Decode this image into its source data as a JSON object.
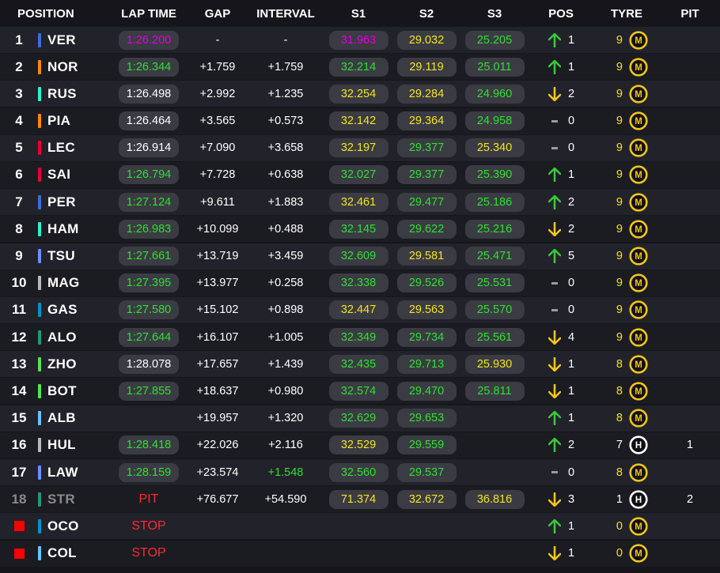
{
  "headers": {
    "position": "POSITION",
    "lap_time": "LAP TIME",
    "gap": "GAP",
    "interval": "INTERVAL",
    "s1": "S1",
    "s2": "S2",
    "s3": "S3",
    "pos": "POS",
    "tyre": "TYRE",
    "pit": "PIT"
  },
  "colors": {
    "purple": "#e100e1",
    "green": "#2ee02e",
    "yellow": "#f5e41a",
    "white": "#ffffff",
    "red_text": "#ff2a2a",
    "grey": "#8a8a8a",
    "tyre_yellow": "#f0c419",
    "tyre_white": "#ffffff",
    "arrow_up": "#37c837",
    "arrow_down": "#f5c41a"
  },
  "rows": [
    {
      "pos": "1",
      "team_color": "#3a6fd8",
      "driver": "VER",
      "lap": "1:26.200",
      "lap_color": "purple",
      "gap": "-",
      "interval": "-",
      "interval_color": "white",
      "s1": "31.963",
      "s1_color": "purple",
      "s2": "29.032",
      "s2_color": "yellow",
      "s3": "25.205",
      "s3_color": "green",
      "change": "up",
      "change_num": "1",
      "laps": "9",
      "laps_color": "yellow",
      "tyre": "M",
      "tyre_icon": "medium-tyre-icon",
      "pit": ""
    },
    {
      "pos": "2",
      "team_color": "#ff8700",
      "driver": "NOR",
      "lap": "1:26.344",
      "lap_color": "green",
      "gap": "+1.759",
      "interval": "+1.759",
      "interval_color": "white",
      "s1": "32.214",
      "s1_color": "green",
      "s2": "29.119",
      "s2_color": "yellow",
      "s3": "25.011",
      "s3_color": "green",
      "change": "up",
      "change_num": "1",
      "laps": "9",
      "laps_color": "yellow",
      "tyre": "M",
      "tyre_icon": "medium-tyre-icon",
      "pit": ""
    },
    {
      "pos": "3",
      "team_color": "#27f4d2",
      "driver": "RUS",
      "lap": "1:26.498",
      "lap_color": "white",
      "gap": "+2.992",
      "interval": "+1.235",
      "interval_color": "white",
      "s1": "32.254",
      "s1_color": "yellow",
      "s2": "29.284",
      "s2_color": "yellow",
      "s3": "24.960",
      "s3_color": "green",
      "change": "down",
      "change_num": "2",
      "laps": "9",
      "laps_color": "yellow",
      "tyre": "M",
      "tyre_icon": "medium-tyre-icon",
      "pit": ""
    },
    {
      "pos": "4",
      "team_color": "#ff8700",
      "driver": "PIA",
      "lap": "1:26.464",
      "lap_color": "white",
      "gap": "+3.565",
      "interval": "+0.573",
      "interval_color": "white",
      "s1": "32.142",
      "s1_color": "yellow",
      "s2": "29.364",
      "s2_color": "yellow",
      "s3": "24.958",
      "s3_color": "green",
      "change": "same",
      "change_num": "0",
      "laps": "9",
      "laps_color": "yellow",
      "tyre": "M",
      "tyre_icon": "medium-tyre-icon",
      "pit": ""
    },
    {
      "pos": "5",
      "team_color": "#e8002d",
      "driver": "LEC",
      "lap": "1:26.914",
      "lap_color": "white",
      "gap": "+7.090",
      "interval": "+3.658",
      "interval_color": "white",
      "s1": "32.197",
      "s1_color": "yellow",
      "s2": "29.377",
      "s2_color": "green",
      "s3": "25.340",
      "s3_color": "yellow",
      "change": "same",
      "change_num": "0",
      "laps": "9",
      "laps_color": "yellow",
      "tyre": "M",
      "tyre_icon": "medium-tyre-icon",
      "pit": ""
    },
    {
      "pos": "6",
      "team_color": "#e8002d",
      "driver": "SAI",
      "lap": "1:26.794",
      "lap_color": "green",
      "gap": "+7.728",
      "interval": "+0.638",
      "interval_color": "white",
      "s1": "32.027",
      "s1_color": "green",
      "s2": "29.377",
      "s2_color": "green",
      "s3": "25.390",
      "s3_color": "green",
      "change": "up",
      "change_num": "1",
      "laps": "9",
      "laps_color": "yellow",
      "tyre": "M",
      "tyre_icon": "medium-tyre-icon",
      "pit": ""
    },
    {
      "pos": "7",
      "team_color": "#3a6fd8",
      "driver": "PER",
      "lap": "1:27.124",
      "lap_color": "green",
      "gap": "+9.611",
      "interval": "+1.883",
      "interval_color": "white",
      "s1": "32.461",
      "s1_color": "yellow",
      "s2": "29.477",
      "s2_color": "green",
      "s3": "25.186",
      "s3_color": "green",
      "change": "up",
      "change_num": "2",
      "laps": "9",
      "laps_color": "yellow",
      "tyre": "M",
      "tyre_icon": "medium-tyre-icon",
      "pit": ""
    },
    {
      "pos": "8",
      "team_color": "#27f4d2",
      "driver": "HAM",
      "lap": "1:26.983",
      "lap_color": "green",
      "gap": "+10.099",
      "interval": "+0.488",
      "interval_color": "white",
      "s1": "32.145",
      "s1_color": "green",
      "s2": "29.622",
      "s2_color": "green",
      "s3": "25.216",
      "s3_color": "green",
      "change": "down",
      "change_num": "2",
      "laps": "9",
      "laps_color": "yellow",
      "tyre": "M",
      "tyre_icon": "medium-tyre-icon",
      "pit": ""
    },
    {
      "pos": "9",
      "team_color": "#6692ff",
      "driver": "TSU",
      "lap": "1:27.661",
      "lap_color": "green",
      "gap": "+13.719",
      "interval": "+3.459",
      "interval_color": "white",
      "s1": "32.609",
      "s1_color": "green",
      "s2": "29.581",
      "s2_color": "yellow",
      "s3": "25.471",
      "s3_color": "green",
      "change": "up",
      "change_num": "5",
      "laps": "9",
      "laps_color": "yellow",
      "tyre": "M",
      "tyre_icon": "medium-tyre-icon",
      "pit": ""
    },
    {
      "pos": "10",
      "team_color": "#b6babd",
      "driver": "MAG",
      "lap": "1:27.395",
      "lap_color": "green",
      "gap": "+13.977",
      "interval": "+0.258",
      "interval_color": "white",
      "s1": "32.338",
      "s1_color": "green",
      "s2": "29.526",
      "s2_color": "green",
      "s3": "25.531",
      "s3_color": "green",
      "change": "same",
      "change_num": "0",
      "laps": "9",
      "laps_color": "yellow",
      "tyre": "M",
      "tyre_icon": "medium-tyre-icon",
      "pit": ""
    },
    {
      "pos": "11",
      "team_color": "#0093cc",
      "driver": "GAS",
      "lap": "1:27.580",
      "lap_color": "green",
      "gap": "+15.102",
      "interval": "+0.898",
      "interval_color": "white",
      "s1": "32.447",
      "s1_color": "yellow",
      "s2": "29.563",
      "s2_color": "yellow",
      "s3": "25.570",
      "s3_color": "green",
      "change": "same",
      "change_num": "0",
      "laps": "9",
      "laps_color": "yellow",
      "tyre": "M",
      "tyre_icon": "medium-tyre-icon",
      "pit": ""
    },
    {
      "pos": "12",
      "team_color": "#229971",
      "driver": "ALO",
      "lap": "1:27.644",
      "lap_color": "green",
      "gap": "+16.107",
      "interval": "+1.005",
      "interval_color": "white",
      "s1": "32.349",
      "s1_color": "green",
      "s2": "29.734",
      "s2_color": "green",
      "s3": "25.561",
      "s3_color": "green",
      "change": "down",
      "change_num": "4",
      "laps": "9",
      "laps_color": "yellow",
      "tyre": "M",
      "tyre_icon": "medium-tyre-icon",
      "pit": ""
    },
    {
      "pos": "13",
      "team_color": "#52e252",
      "driver": "ZHO",
      "lap": "1:28.078",
      "lap_color": "white",
      "gap": "+17.657",
      "interval": "+1.439",
      "interval_color": "white",
      "s1": "32.435",
      "s1_color": "green",
      "s2": "29.713",
      "s2_color": "green",
      "s3": "25.930",
      "s3_color": "yellow",
      "change": "down",
      "change_num": "1",
      "laps": "8",
      "laps_color": "yellow",
      "tyre": "M",
      "tyre_icon": "medium-tyre-icon",
      "pit": ""
    },
    {
      "pos": "14",
      "team_color": "#52e252",
      "driver": "BOT",
      "lap": "1:27.855",
      "lap_color": "green",
      "gap": "+18.637",
      "interval": "+0.980",
      "interval_color": "white",
      "s1": "32.574",
      "s1_color": "green",
      "s2": "29.470",
      "s2_color": "green",
      "s3": "25.811",
      "s3_color": "green",
      "change": "down",
      "change_num": "1",
      "laps": "8",
      "laps_color": "yellow",
      "tyre": "M",
      "tyre_icon": "medium-tyre-icon",
      "pit": ""
    },
    {
      "pos": "15",
      "team_color": "#64c4ff",
      "driver": "ALB",
      "lap": "",
      "lap_color": "white",
      "gap": "+19.957",
      "interval": "+1.320",
      "interval_color": "white",
      "s1": "32.629",
      "s1_color": "green",
      "s2": "29.653",
      "s2_color": "green",
      "s3": "",
      "s3_color": "white",
      "change": "up",
      "change_num": "1",
      "laps": "8",
      "laps_color": "yellow",
      "tyre": "M",
      "tyre_icon": "medium-tyre-icon",
      "pit": ""
    },
    {
      "pos": "16",
      "team_color": "#b6babd",
      "driver": "HUL",
      "lap": "1:28.418",
      "lap_color": "green",
      "gap": "+22.026",
      "interval": "+2.116",
      "interval_color": "white",
      "s1": "32.529",
      "s1_color": "yellow",
      "s2": "29.559",
      "s2_color": "green",
      "s3": "",
      "s3_color": "white",
      "change": "up",
      "change_num": "2",
      "laps": "7",
      "laps_color": "white",
      "tyre": "H",
      "tyre_icon": "hard-tyre-icon",
      "pit": "1"
    },
    {
      "pos": "17",
      "team_color": "#6692ff",
      "driver": "LAW",
      "lap": "1:28.159",
      "lap_color": "green",
      "gap": "+23.574",
      "interval": "+1.548",
      "interval_color": "green",
      "s1": "32.560",
      "s1_color": "green",
      "s2": "29.537",
      "s2_color": "green",
      "s3": "",
      "s3_color": "white",
      "change": "same",
      "change_num": "0",
      "laps": "8",
      "laps_color": "yellow",
      "tyre": "M",
      "tyre_icon": "medium-tyre-icon",
      "pit": ""
    },
    {
      "pos": "18",
      "team_color": "#229971",
      "driver": "STR",
      "lap": "PIT",
      "lap_color": "red",
      "gap": "+76.677",
      "interval": "+54.590",
      "interval_color": "white",
      "s1": "71.374",
      "s1_color": "yellow",
      "s2": "32.672",
      "s2_color": "yellow",
      "s3": "36.816",
      "s3_color": "yellow",
      "change": "down",
      "change_num": "3",
      "laps": "1",
      "laps_color": "white",
      "tyre": "H",
      "tyre_icon": "hard-tyre-icon",
      "pit": "2",
      "dim": true
    },
    {
      "pos": "",
      "team_color": "#0093cc",
      "driver": "OCO",
      "lap": "STOP",
      "lap_color": "red",
      "gap": "",
      "interval": "",
      "interval_color": "white",
      "s1": "",
      "s1_color": "white",
      "s2": "",
      "s2_color": "white",
      "s3": "",
      "s3_color": "white",
      "change": "up",
      "change_num": "1",
      "laps": "0",
      "laps_color": "yellow",
      "tyre": "M",
      "tyre_icon": "medium-tyre-icon",
      "pit": "",
      "stopped": true
    },
    {
      "pos": "",
      "team_color": "#64c4ff",
      "driver": "COL",
      "lap": "STOP",
      "lap_color": "red",
      "gap": "",
      "interval": "",
      "interval_color": "white",
      "s1": "",
      "s1_color": "white",
      "s2": "",
      "s2_color": "white",
      "s3": "",
      "s3_color": "white",
      "change": "down",
      "change_num": "1",
      "laps": "0",
      "laps_color": "yellow",
      "tyre": "M",
      "tyre_icon": "medium-tyre-icon",
      "pit": "",
      "stopped": true
    }
  ]
}
